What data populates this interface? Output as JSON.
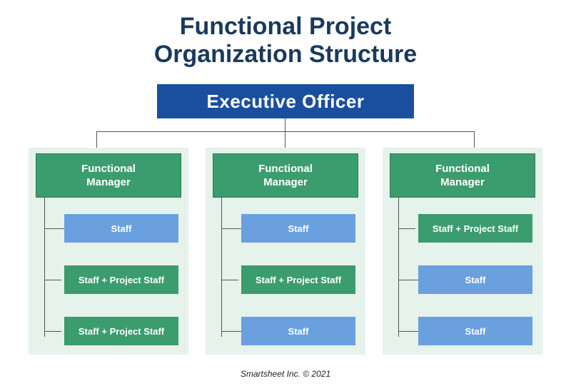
{
  "title_line1": "Functional Project",
  "title_line2": "Organization Structure",
  "executive": "Executive Officer",
  "managers": [
    {
      "label_line1": "Functional",
      "label_line2": "Manager",
      "staff": [
        {
          "label": "Staff",
          "type": "blue"
        },
        {
          "label": "Staff + Project Staff",
          "type": "green"
        },
        {
          "label": "Staff + Project Staff",
          "type": "green"
        }
      ]
    },
    {
      "label_line1": "Functional",
      "label_line2": "Manager",
      "staff": [
        {
          "label": "Staff",
          "type": "blue"
        },
        {
          "label": "Staff + Project Staff",
          "type": "green"
        },
        {
          "label": "Staff",
          "type": "blue"
        }
      ]
    },
    {
      "label_line1": "Functional",
      "label_line2": "Manager",
      "staff": [
        {
          "label": "Staff + Project Staff",
          "type": "green"
        },
        {
          "label": "Staff",
          "type": "blue"
        },
        {
          "label": "Staff",
          "type": "blue"
        }
      ]
    }
  ],
  "footer": "Smartsheet Inc. © 2021",
  "colors": {
    "title": "#1a3a5c",
    "exec_bg": "#1a4fa0",
    "mgr_bg": "#3b9c6e",
    "group_bg": "#e6f2ec",
    "staff_blue": "#6aa0e0"
  }
}
